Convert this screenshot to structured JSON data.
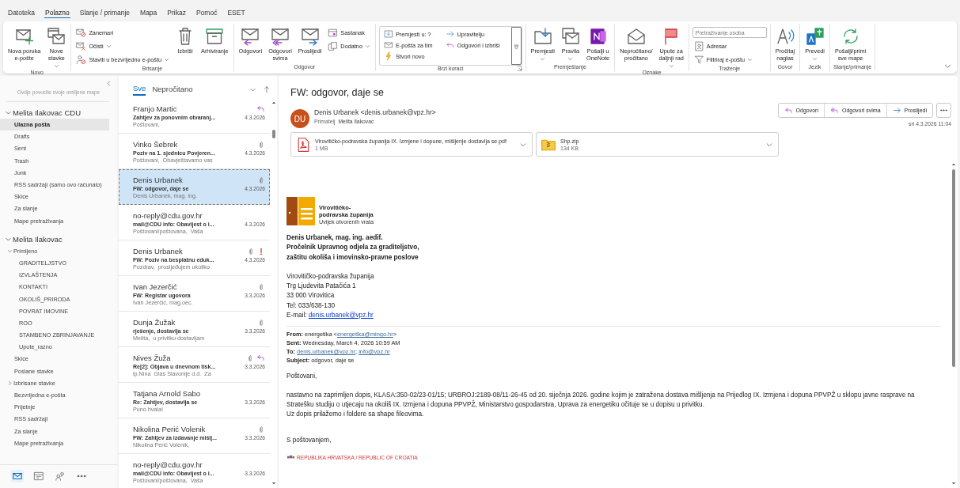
{
  "menu_tabs": [
    {
      "label": "Datoteka",
      "selected": false
    },
    {
      "label": "Polazno",
      "selected": true
    },
    {
      "label": "Slanje / primanje",
      "selected": false
    },
    {
      "label": "Mapa",
      "selected": false
    },
    {
      "label": "Prikaz",
      "selected": false
    },
    {
      "label": "Pomoć",
      "selected": false
    },
    {
      "label": "ESET",
      "selected": false
    }
  ],
  "ribbon": {
    "groups": [
      {
        "label": "Novo",
        "launcher": false,
        "items": [
          {
            "kind": "large",
            "lines": [
              "Nova poruka",
              "e-pošte"
            ],
            "dropdown": false
          },
          {
            "kind": "large",
            "lines": [
              "Nove",
              "stavke"
            ],
            "dropdown": true
          }
        ]
      },
      {
        "label": "Brisanje",
        "launcher": false,
        "items": [
          {
            "kind": "stack",
            "items": [
              {
                "kind": "small",
                "label": "Zanemari",
                "dropdown": false
              },
              {
                "kind": "small",
                "label": "Očisti",
                "dropdown": true
              },
              {
                "kind": "small",
                "label": "Staviti u bezvrijednu e-poštu",
                "dropdown": true
              }
            ]
          },
          {
            "kind": "large",
            "lines": [
              "Izbriši"
            ],
            "dropdown": false
          },
          {
            "kind": "large",
            "lines": [
              "Arhiviranje"
            ],
            "dropdown": false
          }
        ]
      },
      {
        "label": "Odgovor",
        "launcher": false,
        "items": [
          {
            "kind": "large",
            "lines": [
              "Odgovori"
            ],
            "dropdown": false
          },
          {
            "kind": "large",
            "lines": [
              "Odgovori",
              "svima"
            ],
            "dropdown": false
          },
          {
            "kind": "large",
            "lines": [
              "Proslijedi"
            ],
            "dropdown": false
          },
          {
            "kind": "stack",
            "items": [
              {
                "kind": "small",
                "label": "Sastanak",
                "dropdown": false
              },
              {
                "kind": "small",
                "label": "Dodatno",
                "dropdown": true
              }
            ]
          }
        ]
      },
      {
        "label": "Brzi koraci",
        "launcher": true,
        "items": [
          {
            "kind": "quicksteps",
            "columns": [
              [
                "Premjesti u: ?",
                "E-pošta za tim",
                "Stvori novo"
              ],
              [
                "Upravitelju",
                "Odgovori i izbriši"
              ]
            ]
          }
        ]
      },
      {
        "label": "Premještanje",
        "launcher": false,
        "items": [
          {
            "kind": "large",
            "lines": [
              "Premjesti"
            ],
            "dropdown": true
          },
          {
            "kind": "large",
            "lines": [
              "Pravila"
            ],
            "dropdown": true
          },
          {
            "kind": "large",
            "lines": [
              "Pošalji u",
              "OneNote"
            ],
            "dropdown": false
          }
        ]
      },
      {
        "label": "Oznake",
        "launcher": false,
        "items": [
          {
            "kind": "large",
            "lines": [
              "Nepročitano/",
              "pročitano"
            ],
            "dropdown": false
          },
          {
            "kind": "large",
            "lines": [
              "Upute za",
              "daljnji rad"
            ],
            "dropdown": true
          }
        ]
      },
      {
        "label": "Traženje",
        "launcher": false,
        "items": [
          {
            "kind": "stack",
            "items": [
              {
                "kind": "search",
                "placeholder": "Pretraživanje osoba"
              },
              {
                "kind": "small",
                "label": "Adresar",
                "dropdown": false
              },
              {
                "kind": "small",
                "label": "Filtriraj e-poštu",
                "dropdown": true
              }
            ]
          }
        ]
      },
      {
        "label": "Govor",
        "launcher": false,
        "items": [
          {
            "kind": "large",
            "lines": [
              "Pročitaj",
              "naglas"
            ],
            "dropdown": false
          }
        ]
      },
      {
        "label": "Jezik",
        "launcher": false,
        "items": [
          {
            "kind": "large",
            "lines": [
              "Prevedi"
            ],
            "dropdown": true
          }
        ]
      },
      {
        "label": "Slanje/primanje",
        "launcher": false,
        "items": [
          {
            "kind": "large",
            "lines": [
              "Pošalji/primi",
              "sve mape"
            ],
            "dropdown": false
          }
        ]
      }
    ]
  },
  "folder_pane": {
    "hint": "Ovdje povucite svoje omiljene mape",
    "accounts": [
      {
        "name": "Melita Ilakovac CDU",
        "expanded": true,
        "folders": [
          {
            "label": "Ulazna pošta",
            "selected": true
          },
          {
            "label": "Drafts",
            "selected": false
          },
          {
            "label": "Sent",
            "selected": false
          },
          {
            "label": "Trash",
            "selected": false
          },
          {
            "label": "Junk",
            "selected": false
          },
          {
            "label": "RSS sadržaji (samo ovo računalo)",
            "selected": false
          },
          {
            "label": "Skice",
            "selected": false
          },
          {
            "label": "Za slanje",
            "selected": false
          },
          {
            "label": "Mape pretraživanja",
            "selected": false
          }
        ]
      },
      {
        "name": "Melita Ilakovac",
        "expanded": true,
        "folders": [
          {
            "label": "Primljeno",
            "selected": false,
            "expanded": true,
            "children": [
              {
                "label": "GRADITELJSTVO",
                "selected": false
              },
              {
                "label": "IZVLAŠTENJA",
                "selected": false
              },
              {
                "label": "KONTAKTI",
                "selected": false
              },
              {
                "label": "OKOLIŠ_PRIRODA",
                "selected": false
              },
              {
                "label": "POVRAT IMOVINE",
                "selected": false
              },
              {
                "label": "ROO",
                "selected": false
              },
              {
                "label": "STAMBENO ZBRINJAVANJE",
                "selected": false
              },
              {
                "label": "Upute_razno",
                "selected": false
              }
            ]
          },
          {
            "label": "Skice",
            "selected": false
          },
          {
            "label": "Poslane stavke",
            "selected": false
          },
          {
            "label": "Izbrisane stavke",
            "selected": false,
            "expanded": false
          },
          {
            "label": "Bezvrijedna e-pošta",
            "selected": false
          },
          {
            "label": "Prijetnje",
            "selected": false
          },
          {
            "label": "RSS sadržaji",
            "selected": false
          },
          {
            "label": "Za slanje",
            "selected": false
          },
          {
            "label": "Mape pretraživanja",
            "selected": false
          }
        ]
      }
    ],
    "nav": [
      {
        "selected": true
      },
      {
        "selected": false
      },
      {
        "selected": false
      },
      {
        "selected": false
      }
    ]
  },
  "message_list": {
    "filters": [
      {
        "label": "Sve",
        "selected": true
      },
      {
        "label": "Nepročitano",
        "selected": false
      }
    ],
    "messages": [
      {
        "sender": "Franjo Martic",
        "subject": "Zahtjev za ponovnim otvaranj...",
        "preview": "Poštovani,",
        "date": "4.3.2026",
        "attachment": false,
        "replied": true,
        "important": false,
        "selected": false
      },
      {
        "sender": "Vinko Šebrek",
        "subject": "Poziv na 1. sjednicu Povjeren...",
        "preview": "Poštovani,  Obavještavamo vas",
        "date": "4.3.2026",
        "attachment": true,
        "replied": false,
        "important": false,
        "selected": false
      },
      {
        "sender": "Denis Urbanek",
        "subject": "FW: odgovor, daje se",
        "preview": "Denis Urbanek, mag. ing.",
        "date": "4.3.2026",
        "attachment": true,
        "replied": false,
        "important": false,
        "selected": true
      },
      {
        "sender": "no-reply@cdu.gov.hr",
        "subject": "mail@CDU info: Obavijest o i...",
        "preview": "Poštovani/poštovana,  Vaša",
        "date": "4.3.2026",
        "attachment": false,
        "replied": false,
        "important": false,
        "selected": false
      },
      {
        "sender": "Denis Urbanek",
        "subject": "FW: Poziv na besplatnu eduk...",
        "preview": "Pozdrav,  prosljeđujem ukoliko",
        "date": "4.3.2026",
        "attachment": true,
        "replied": false,
        "important": true,
        "selected": false
      },
      {
        "sender": "Ivan Jezerčić",
        "subject": "FW: Registar ugovora",
        "preview": "Ivan Jezerčić, mag.oec.",
        "date": "3.3.2026",
        "attachment": true,
        "replied": false,
        "important": false,
        "selected": false
      },
      {
        "sender": "Dunja Žužak",
        "subject": "rješenje, dostavlja se",
        "preview": "Melita,  u privitku dostavljam",
        "date": "3.3.2026",
        "attachment": true,
        "replied": false,
        "important": false,
        "selected": false
      },
      {
        "sender": "Nives Žuža",
        "subject": "Re[2]: Objava u dnevnom tisk...",
        "preview": "lp,Nina  Glas Slavonije d.d.  Za",
        "date": "3.3.2026",
        "attachment": true,
        "replied": true,
        "important": false,
        "selected": false
      },
      {
        "sender": "Tatjana Arnold Sabo",
        "subject": "Re: Zahtjev, dostavlja se",
        "preview": "Puno hvala!",
        "date": "3.3.2026",
        "attachment": false,
        "replied": false,
        "important": false,
        "selected": false
      },
      {
        "sender": "Nikolina Perić Volenik",
        "subject": "FW: Zahtjev za izdavanje mišlj...",
        "preview": "Nikolina Perić Volenik,",
        "date": "3.3.2026",
        "attachment": true,
        "replied": false,
        "important": false,
        "selected": false
      },
      {
        "sender": "no-reply@cdu.gov.hr",
        "subject": "mail@CDU info: Obavijest o i...",
        "preview": "Poštovani/poštovana,  Vaša",
        "date": "3.3.2026",
        "attachment": false,
        "replied": false,
        "important": false,
        "selected": false
      }
    ]
  },
  "reading_pane": {
    "subject": "FW: odgovor, daje se",
    "avatar_initials": "DU",
    "sender": "Denis Urbanek <denis.urbanek@vpz.hr>",
    "recipient_label": "Primatelj",
    "recipient": "Melita Ilakovac",
    "actions": [
      "Odgovori",
      "Odgovori svima",
      "Proslijedi"
    ],
    "date": "sri 4.3.2026 11:04",
    "attachments": [
      {
        "kind": "pdf",
        "name": "Virovitičko-podravska županija IX. Izmjene i dopune, mišljenje dostavlja se.pdf",
        "size": "1 MB"
      },
      {
        "kind": "zip",
        "name": "Shp.zip",
        "size": "134 KB"
      }
    ],
    "body": {
      "logo_lines": [
        "Virovitičko-",
        "podravska županija"
      ],
      "logo_tagline": "Uvijek otvorenih vrata",
      "signature_bold": [
        "Denis Urbanek, mag. ing. aedif.",
        "Pročelnik Upravnog odjela za graditeljstvo,",
        "zaštitu okoliša i imovinsko-pravne poslove"
      ],
      "address": [
        "Virovitičko-podravska županija",
        "Trg Ljudevita Patačića 1",
        "33 000 Virovitica",
        "Tel: 033/638-130"
      ],
      "email_label": "E-mail:",
      "email_link": "denis.urbanek@vpz.hr",
      "headers": [
        {
          "label": "From:",
          "parts": [
            {
              "kind": "text",
              "text": "energetika <"
            },
            {
              "kind": "link",
              "text": "energetika@mingo.hr"
            },
            {
              "kind": "text",
              "text": ">"
            }
          ]
        },
        {
          "label": "Sent:",
          "parts": [
            {
              "kind": "text",
              "text": "Wednesday, March 4, 2026 10:59 AM"
            }
          ]
        },
        {
          "label": "To:",
          "parts": [
            {
              "kind": "link",
              "text": "denis.urbanek@vpz.hr"
            },
            {
              "kind": "text",
              "text": "; "
            },
            {
              "kind": "link",
              "text": "info@vpz.hr"
            }
          ]
        },
        {
          "label": "Subject:",
          "parts": [
            {
              "kind": "text",
              "text": "odgovor, daje se"
            }
          ]
        }
      ],
      "greeting": "Poštovani,",
      "paragraphs": [
        "nastavno na zaprimljen dopis, KLASA:350-02/23-01/15; URBROJ:2189-08/11-26-45 od 20. siječnja 2026. godine kojim je zatražena dostava mišljenja na Prijedlog IX. Izmjena i dopuna PPVPŽ u sklopu javne rasprave na Stratešku studiju o utjecaju na okoliš IX. Izmjena i dopuna PPVPŽ, Ministarstvo gospodarstva, Uprava za energetiku očituje se u dopisu u privitku.",
        "Uz dopis prilažemo i foldere sa shape fileovima."
      ],
      "closing": "S poštovanjem,",
      "footer": "REPUBLIKA HRVATSKA / REPUBLIC OF CROATIA"
    }
  }
}
